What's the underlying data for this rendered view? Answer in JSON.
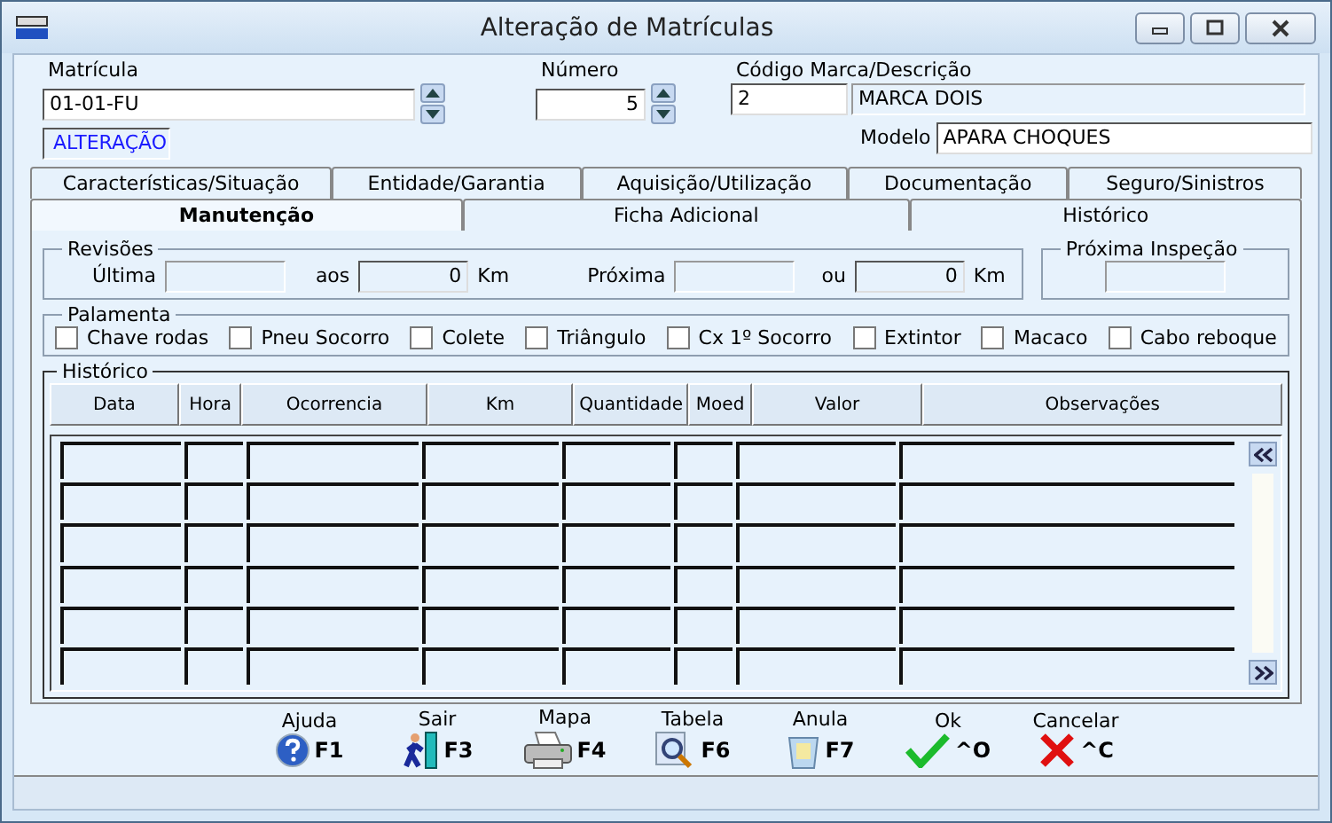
{
  "window": {
    "title": "Alteração de Matrículas"
  },
  "header": {
    "matricula": {
      "label": "Matrícula",
      "value": "01-01-FU"
    },
    "mode": "ALTERAÇÃO",
    "numero": {
      "label": "Número",
      "value": "5"
    },
    "marca": {
      "label": "Código Marca/Descrição",
      "code": "2",
      "description": "MARCA DOIS"
    },
    "modelo": {
      "label": "Modelo",
      "value": "APARA CHOQUES"
    }
  },
  "tabs_back": [
    {
      "label": "Características/Situação",
      "selected": false
    },
    {
      "label": "Entidade/Garantia",
      "selected": false
    },
    {
      "label": "Aquisição/Utilização",
      "selected": false
    },
    {
      "label": "Documentação",
      "selected": false
    },
    {
      "label": "Seguro/Sinistros",
      "selected": false
    }
  ],
  "tabs_front": [
    {
      "label": "Manutenção",
      "selected": true
    },
    {
      "label": "Ficha Adicional",
      "selected": false
    },
    {
      "label": "Histórico",
      "selected": false
    }
  ],
  "revisoes": {
    "title": "Revisões",
    "ultima_label": "Última",
    "aos_label": "aos",
    "aos_value": "0",
    "aos_unit": "Km",
    "proxima_label": "Próxima",
    "ou_label": "ou",
    "ou_value": "0",
    "ou_unit": "Km"
  },
  "proxima_inspecao": {
    "title": "Próxima Inspeção"
  },
  "palamenta": {
    "title": "Palamenta",
    "items": [
      {
        "label": "Chave rodas",
        "checked": false
      },
      {
        "label": "Pneu Socorro",
        "checked": false
      },
      {
        "label": "Colete",
        "checked": false
      },
      {
        "label": "Triângulo",
        "checked": false
      },
      {
        "label": "Cx 1º Socorro",
        "checked": false
      },
      {
        "label": "Extintor",
        "checked": false
      },
      {
        "label": "Macaco",
        "checked": false
      },
      {
        "label": "Cabo reboque",
        "checked": false
      }
    ]
  },
  "historico": {
    "title": "Histórico",
    "columns": [
      "Data",
      "Hora",
      "Ocorrencia",
      "Km",
      "Quantidade",
      "Moed",
      "Valor",
      "Observações"
    ]
  },
  "toolbar": [
    {
      "label": "Ajuda",
      "key": "F1",
      "kind": "help"
    },
    {
      "label": "Sair",
      "key": "F3",
      "kind": "exit"
    },
    {
      "label": "Mapa",
      "key": "F4",
      "kind": "print"
    },
    {
      "label": "Tabela",
      "key": "F6",
      "kind": "search"
    },
    {
      "label": "Anula",
      "key": "F7",
      "kind": "trash"
    },
    {
      "label": "Ok",
      "key": "^O",
      "kind": "ok"
    },
    {
      "label": "Cancelar",
      "key": "^C",
      "kind": "cancel"
    }
  ]
}
